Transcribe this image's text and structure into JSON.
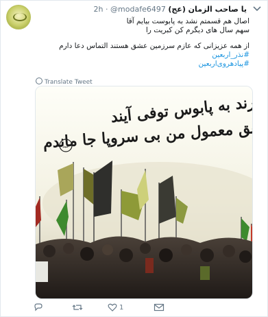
{
  "tweet": {
    "display_name": "یا صاحب الزمان (عج)",
    "handle": "@modafe6497",
    "separator": "·",
    "time": "2h",
    "text_lines": [
      "اصال هم قسمتم نشد به پابوست بیایم آقا",
      "سهم سال های دیگرم کن کبریت را"
    ],
    "text_line_3": "از همه عزیزانی که عازم سرزمین عشق هستند التماس دعا دارم",
    "hashtags": [
      "#نذر_اربعین",
      "#پیادهروی‌اربعین"
    ],
    "translate_label": "Translate Tweet",
    "media": {
      "calligraphy_line1": "همه دارند به پابوس توفی آیند",
      "calligraphy_line2": "طبق معمول من بی سروپا جا ماندم",
      "signature": "عبد"
    },
    "actions": {
      "like_count": "1"
    },
    "icons": {
      "reply": "reply-icon",
      "retweet": "retweet-icon",
      "like": "heart-icon",
      "dm": "envelope-icon",
      "menu": "chevron-down-icon"
    },
    "colors": {
      "link": "#1b95e0",
      "muted": "#657786",
      "text": "#14171a"
    }
  }
}
